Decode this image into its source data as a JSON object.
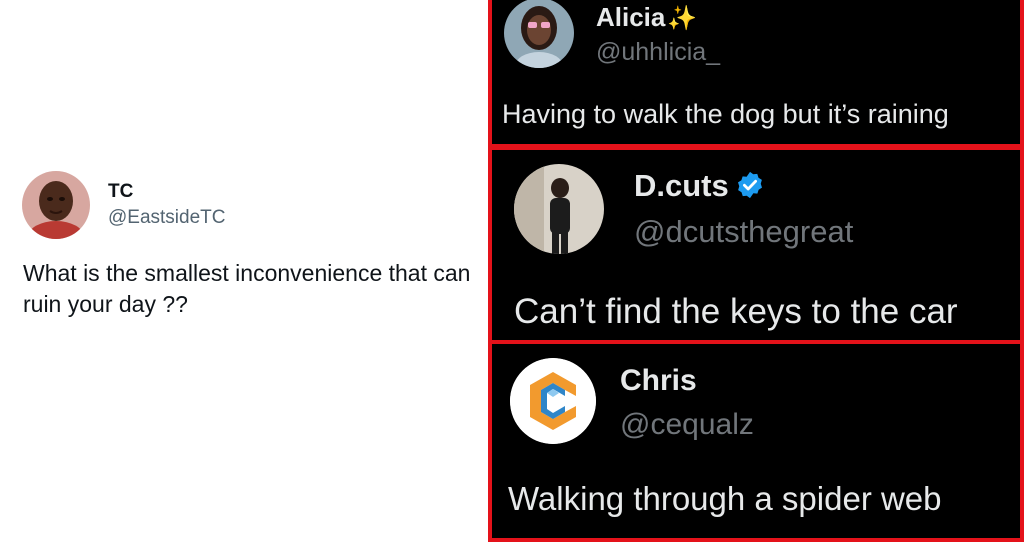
{
  "original_tweet": {
    "name": "TC",
    "handle": "@EastsideTC",
    "text": "What is the smallest inconvenience that can ruin your day ??",
    "avatar_icon": "child-portrait-avatar"
  },
  "replies": [
    {
      "name": "Alicia",
      "name_emoji": "✨",
      "handle": "@uhhlicia_",
      "text": "Having to walk the dog but it’s raining",
      "avatar_icon": "woman-portrait-avatar"
    },
    {
      "name": "D.cuts",
      "verified": true,
      "handle": "@dcutsthegreat",
      "text": "Can’t find the keys to the car",
      "avatar_icon": "man-mirror-selfie-avatar"
    },
    {
      "name": "Chris",
      "handle": "@cequalz",
      "text": "Walking through a spider web",
      "avatar_icon": "c-cube-logo-avatar"
    }
  ],
  "colors": {
    "panel_border": "#e4121a",
    "panel_bg": "#000000",
    "verified_blue": "#1d9bf0",
    "sparkle": "#f7c634"
  }
}
